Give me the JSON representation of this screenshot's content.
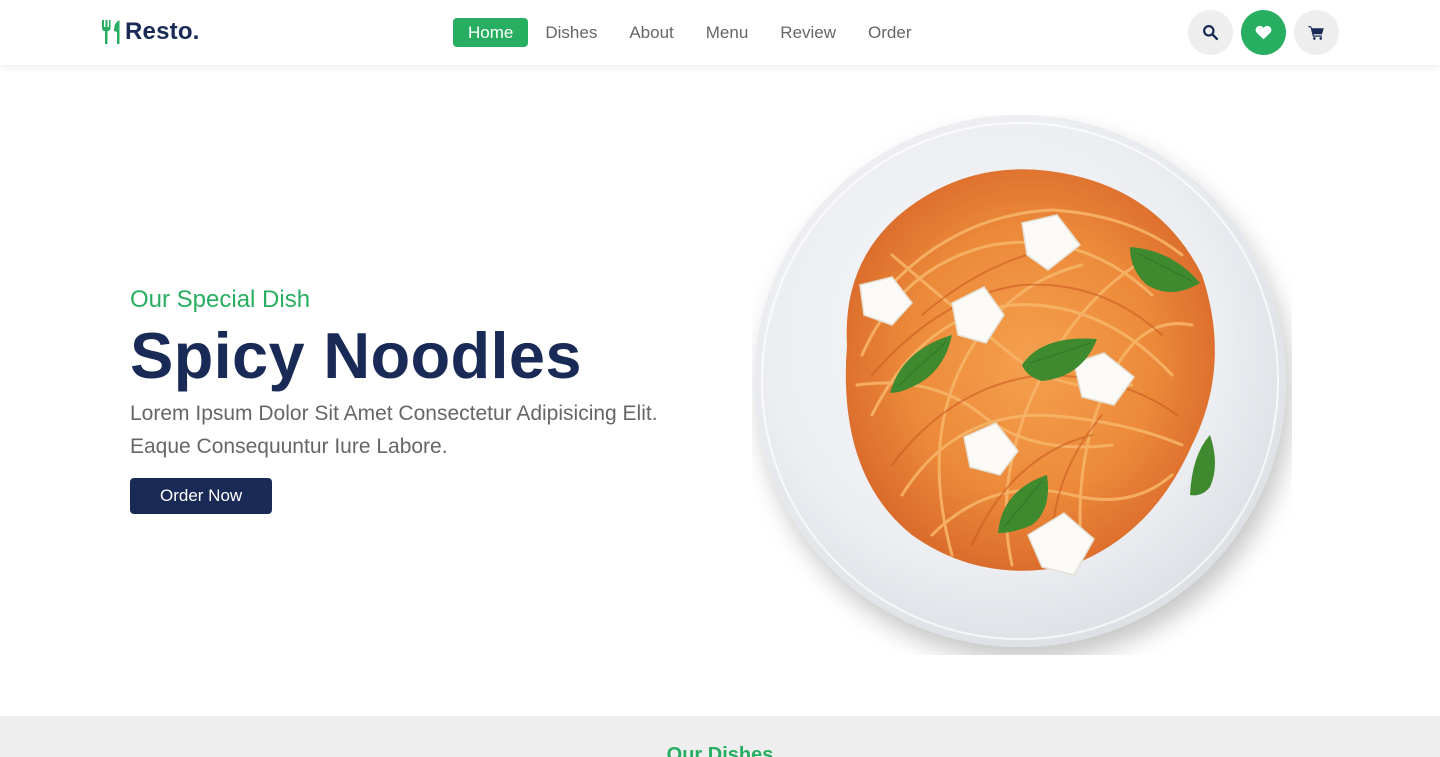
{
  "header": {
    "logo_text": "Resto.",
    "nav": [
      {
        "label": "Home",
        "active": true
      },
      {
        "label": "Dishes",
        "active": false
      },
      {
        "label": "About",
        "active": false
      },
      {
        "label": "Menu",
        "active": false
      },
      {
        "label": "Review",
        "active": false
      },
      {
        "label": "Order",
        "active": false
      }
    ],
    "icons": [
      "search-icon",
      "heart-icon",
      "cart-icon"
    ]
  },
  "hero": {
    "subtitle": "Our Special Dish",
    "title": "Spicy Noodles",
    "description": "Lorem Ipsum Dolor Sit Amet Consectetur Adipisicing Elit. Eaque Consequuntur Iure Labore.",
    "button_label": "Order Now",
    "image": "spaghetti-plate"
  },
  "next_section": {
    "heading": "Our Dishes"
  },
  "colors": {
    "accent": "#27ae60",
    "dark": "#192a56",
    "text": "#666666",
    "light_bg": "#eeeeee"
  }
}
